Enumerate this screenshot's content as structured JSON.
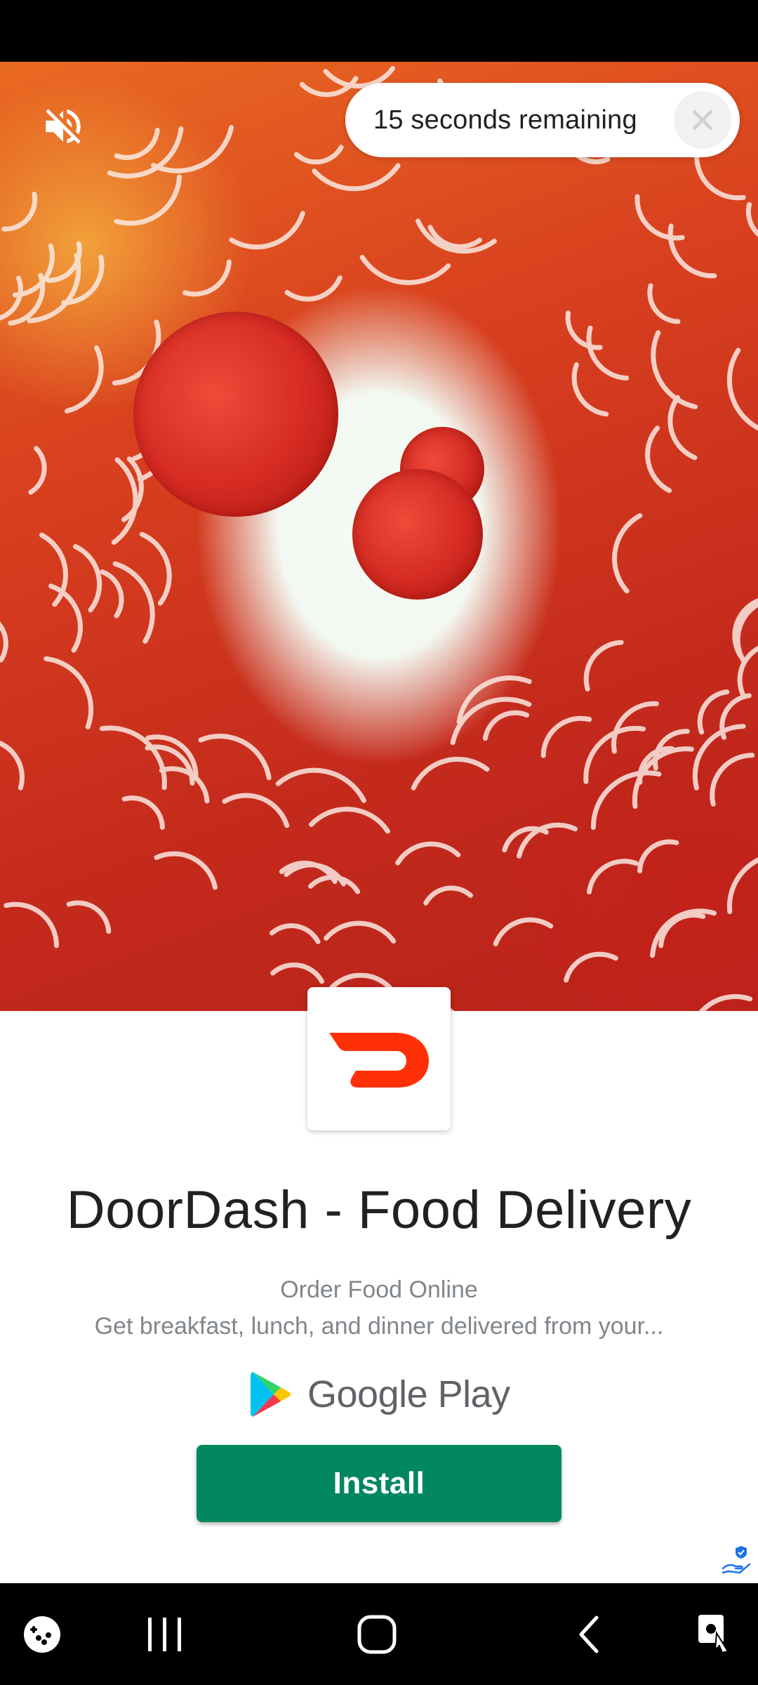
{
  "ad": {
    "timer_text": "15 seconds remaining",
    "app_title": "DoorDash - Food Delivery",
    "app_subtitle": "Order Food Online",
    "app_description": "Get breakfast, lunch, and dinner delivered from your...",
    "store_name": "Google Play",
    "install_label": "Install",
    "install_color": "#01875f",
    "brand_color": "#ff3008"
  },
  "icons": {
    "mute": "volume-muted-icon",
    "close": "close-icon",
    "app": "doordash-logo-icon",
    "store": "google-play-logo-icon",
    "adchoices": "adchoices-icon"
  },
  "nav": {
    "items": [
      "game-launcher-icon",
      "recent-apps-icon",
      "home-icon",
      "back-icon",
      "screen-assist-icon"
    ]
  }
}
